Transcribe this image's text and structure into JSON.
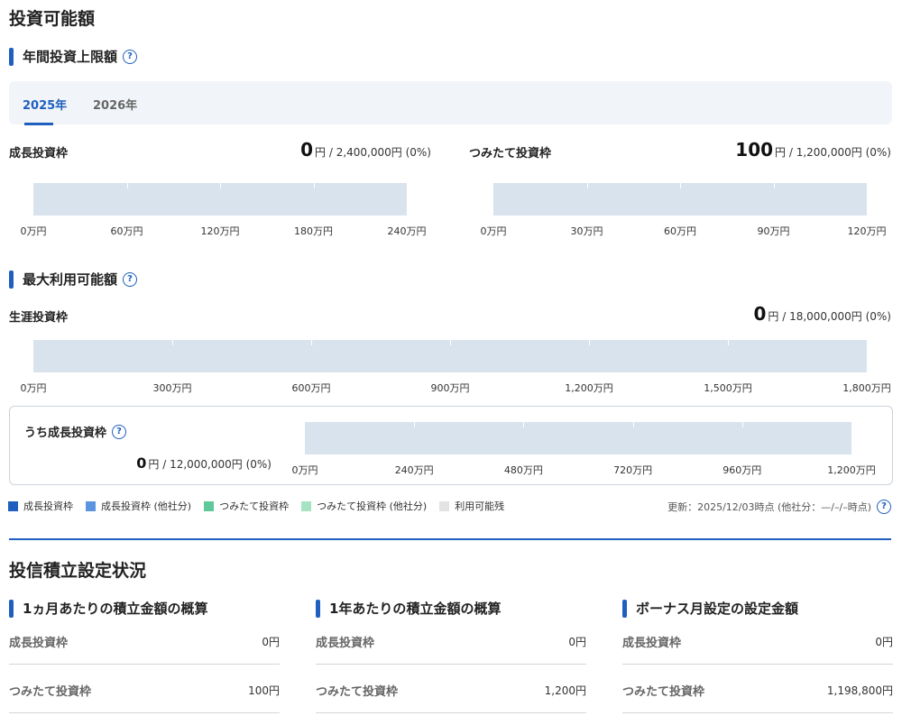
{
  "page": {
    "title": "投資可能額"
  },
  "annual_limit": {
    "title": "年間投資上限額",
    "tabs": [
      {
        "label": "2025年",
        "active": true
      },
      {
        "label": "2026年",
        "active": false
      }
    ],
    "growth": {
      "label": "成長投資枠",
      "amount": "0",
      "unit_total": "円 / 2,400,000円 (0%)",
      "usage_fraction": 0,
      "axis": [
        "0万円",
        "60万円",
        "120万円",
        "180万円",
        "240万円"
      ]
    },
    "tsumitate": {
      "label": "つみたて投資枠",
      "amount": "100",
      "unit_total": "円 / 1,200,000円 (0%)",
      "usage_fraction": 0,
      "axis": [
        "0万円",
        "30万円",
        "60万円",
        "90万円",
        "120万円"
      ]
    }
  },
  "max_available": {
    "title": "最大利用可能額",
    "lifetime": {
      "label": "生涯投資枠",
      "amount": "0",
      "unit_total": "円 / 18,000,000円 (0%)",
      "usage_fraction": 0,
      "axis": [
        "0万円",
        "300万円",
        "600万円",
        "900万円",
        "1,200万円",
        "1,500万円",
        "1,800万円"
      ]
    },
    "growth_portion": {
      "label": "うち成長投資枠",
      "amount": "0",
      "unit_total": "円 / 12,000,000円 (0%)",
      "usage_fraction": 0,
      "axis": [
        "0万円",
        "240万円",
        "480万円",
        "720万円",
        "960万円",
        "1,200万円"
      ]
    }
  },
  "legend": [
    {
      "label": "成長投資枠",
      "color": "#1f5fbf"
    },
    {
      "label": "成長投資枠 (他社分)",
      "color": "#5b95e0"
    },
    {
      "label": "つみたて投資枠",
      "color": "#5fc89a"
    },
    {
      "label": "つみたて投資枠 (他社分)",
      "color": "#a6e3c2"
    },
    {
      "label": "利用可能残",
      "color": "#e3e3e3"
    }
  ],
  "updated": "更新：2025/12/03時点 (他社分：—/–/–時点)",
  "fund_settings": {
    "title": "投信積立設定状況",
    "columns": [
      {
        "title": "1ヵ月あたりの積立金額の概算",
        "rows": [
          {
            "label": "成長投資枠",
            "value": "0円"
          },
          {
            "label": "つみたて投資枠",
            "value": "100円"
          }
        ]
      },
      {
        "title": "1年あたりの積立金額の概算",
        "rows": [
          {
            "label": "成長投資枠",
            "value": "0円"
          },
          {
            "label": "つみたて投資枠",
            "value": "1,200円"
          }
        ]
      },
      {
        "title": "ボーナス月設定の設定金額",
        "rows": [
          {
            "label": "成長投資枠",
            "value": "0円"
          },
          {
            "label": "つみたて投資枠",
            "value": "1,198,800円"
          }
        ]
      }
    ]
  },
  "help_icon": "question-circle-icon"
}
